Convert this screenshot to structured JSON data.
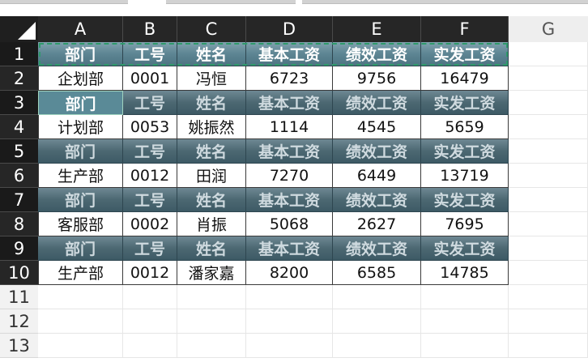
{
  "columns": [
    "A",
    "B",
    "C",
    "D",
    "E",
    "F",
    "G"
  ],
  "row_numbers": [
    "1",
    "2",
    "3",
    "4",
    "5",
    "6",
    "7",
    "8",
    "9",
    "10",
    "11",
    "12",
    "13"
  ],
  "header_labels": [
    "部门",
    "工号",
    "姓名",
    "基本工资",
    "绩效工资",
    "实发工资"
  ],
  "records": [
    [
      "企划部",
      "0001",
      "冯恒",
      "6723",
      "9756",
      "16479"
    ],
    [
      "计划部",
      "0053",
      "姚振然",
      "1114",
      "4545",
      "5659"
    ],
    [
      "生产部",
      "0012",
      "田润",
      "7270",
      "6449",
      "13719"
    ],
    [
      "客服部",
      "0002",
      "肖振",
      "5068",
      "2627",
      "7695"
    ],
    [
      "生产部",
      "0012",
      "潘家嘉",
      "8200",
      "6585",
      "14785"
    ]
  ],
  "colors": {
    "header_fill": "#4c6872",
    "header_text": "#cfdadf",
    "selection_marquee": "#2f9a6b",
    "grid_header_bg": "#262626"
  }
}
